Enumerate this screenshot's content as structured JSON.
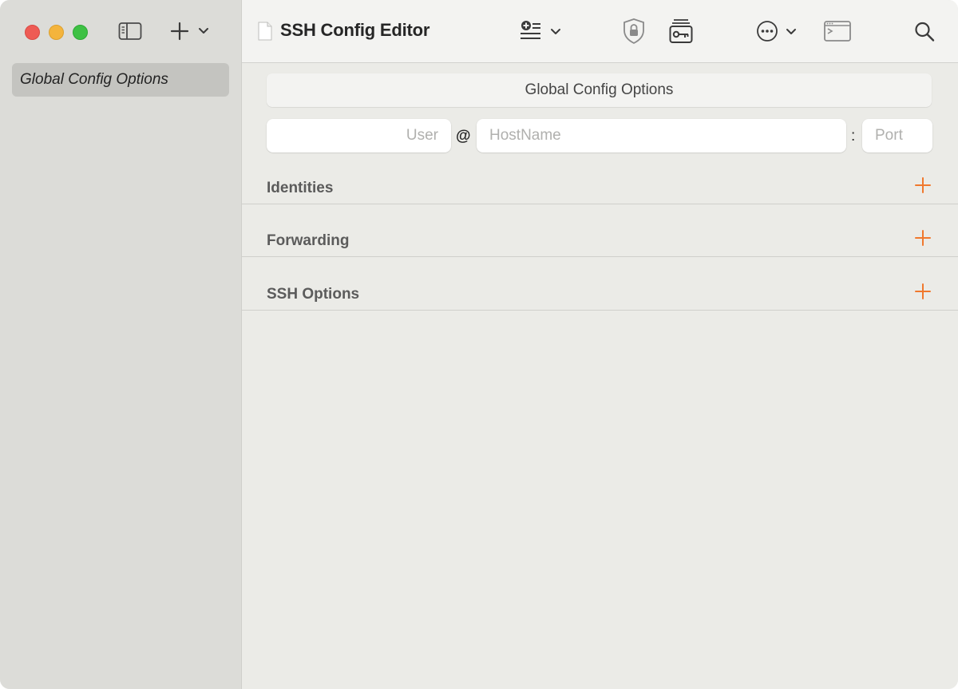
{
  "window": {
    "title": "SSH Config Editor"
  },
  "sidebar": {
    "items": [
      {
        "label": "Global Config Options",
        "selected": true
      }
    ]
  },
  "toolbar": {
    "icons": [
      "sidebar-toggle-icon",
      "plus-icon",
      "chevron-down-icon",
      "document-icon",
      "add-list-icon",
      "shield-lock-icon",
      "key-card-icon",
      "ellipsis-circle-icon",
      "terminal-icon",
      "search-icon"
    ]
  },
  "editor": {
    "header_label": "Global Config Options",
    "user": {
      "value": "",
      "placeholder": "User"
    },
    "at_sign": "@",
    "hostname": {
      "value": "",
      "placeholder": "HostName"
    },
    "colon": ":",
    "port": {
      "value": "",
      "placeholder": "Port"
    },
    "sections": [
      {
        "label": "Identities"
      },
      {
        "label": "Forwarding"
      },
      {
        "label": "SSH Options"
      }
    ]
  },
  "colors": {
    "accent": "#f0782d",
    "close": "#ee5b54",
    "minimize": "#f4b43c",
    "zoom": "#3ec144"
  }
}
